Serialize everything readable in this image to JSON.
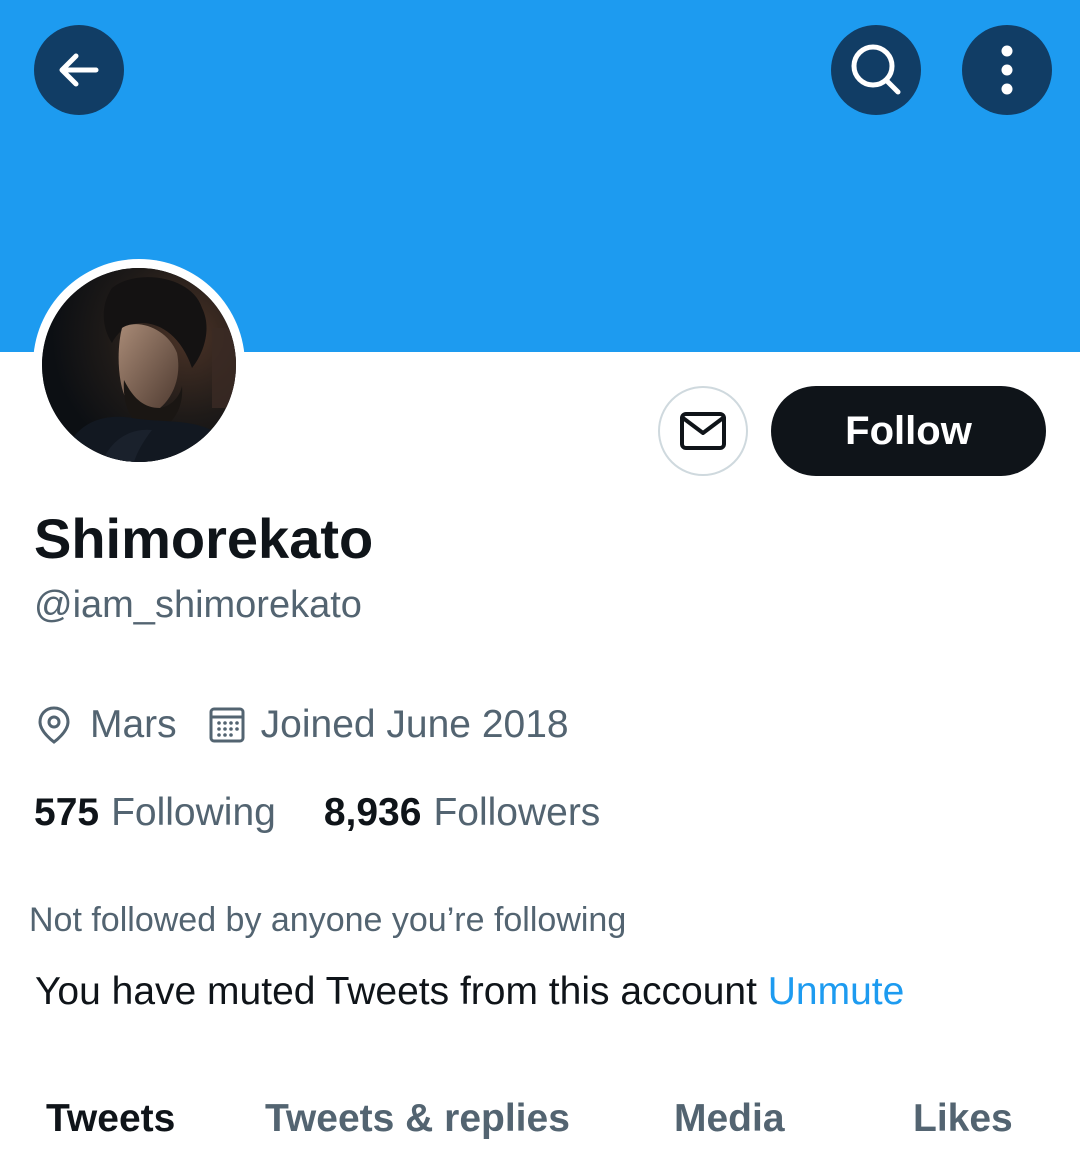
{
  "profile": {
    "display_name": "Shimorekato",
    "handle": "@iam_shimorekato",
    "location": "Mars",
    "joined": "Joined June 2018",
    "following_count": "575",
    "following_label": "Following",
    "followers_count": "8,936",
    "followers_label": "Followers"
  },
  "actions": {
    "follow_label": "Follow"
  },
  "notices": {
    "not_followed": "Not followed by anyone you’re following",
    "muted_text": "You have muted Tweets from this account",
    "unmute_label": "Unmute"
  },
  "tabs": [
    {
      "label": "Tweets",
      "active": true
    },
    {
      "label": "Tweets & replies",
      "active": false
    },
    {
      "label": "Media",
      "active": false
    },
    {
      "label": "Likes",
      "active": false
    }
  ],
  "icons": {
    "back": "arrow-left-icon",
    "search": "search-icon",
    "more": "more-vertical-icon",
    "message": "envelope-icon",
    "location": "location-pin-icon",
    "calendar": "calendar-icon"
  },
  "colors": {
    "banner": "#1d9bf0",
    "accent": "#1d9bf0",
    "primary_text": "#0f1419",
    "secondary_text": "#536471",
    "follow_button": "#0f1419"
  }
}
